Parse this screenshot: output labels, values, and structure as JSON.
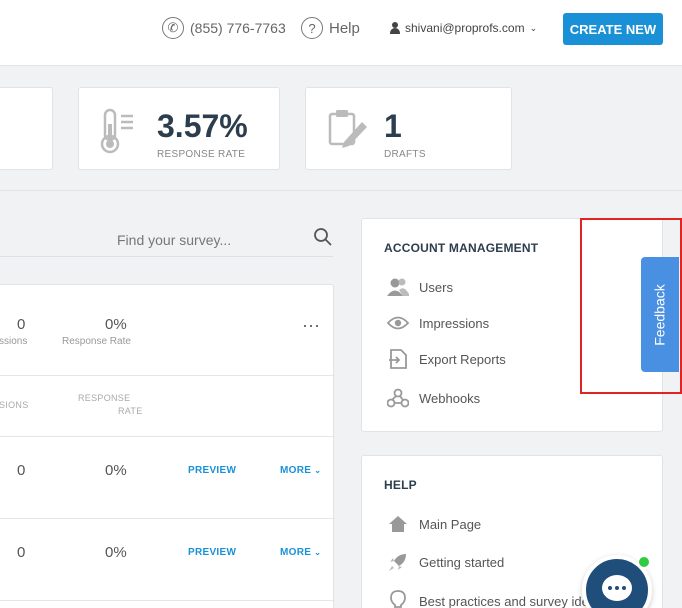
{
  "header": {
    "phone": "(855) 776-7763",
    "help_label": "Help",
    "user_email": "shivani@proprofs.com",
    "create_label": "CREATE NEW"
  },
  "stats": [
    {
      "value": "3.57%",
      "label": "RESPONSE RATE",
      "icon": "thermometer-icon"
    },
    {
      "value": "1",
      "label": "DRAFTS",
      "icon": "clipboard-pencil-icon"
    }
  ],
  "search": {
    "placeholder": "Find your survey..."
  },
  "survey_card": {
    "summary": {
      "impressions_value": "0",
      "impressions_label": "ssions",
      "response_value": "0%",
      "response_label": "Response Rate"
    },
    "columns": {
      "impressions": "SIONS",
      "response_line1": "RESPONSE",
      "response_line2": "RATE"
    },
    "rows": [
      {
        "impressions": "0",
        "response": "0%",
        "preview": "PREVIEW",
        "more": "MORE"
      },
      {
        "impressions": "0",
        "response": "0%",
        "preview": "PREVIEW",
        "more": "MORE"
      }
    ]
  },
  "account": {
    "title": "ACCOUNT MANAGEMENT",
    "items": [
      {
        "label": "Users",
        "icon": "users-icon"
      },
      {
        "label": "Impressions",
        "icon": "eye-icon"
      },
      {
        "label": "Export Reports",
        "icon": "export-icon"
      },
      {
        "label": "Webhooks",
        "icon": "webhook-icon"
      }
    ]
  },
  "help_card": {
    "title": "HELP",
    "items": [
      {
        "label": "Main Page",
        "icon": "home-icon"
      },
      {
        "label": "Getting started",
        "icon": "rocket-icon"
      },
      {
        "label": "Best practices and survey ide",
        "icon": "lightbulb-icon"
      }
    ]
  },
  "feedback": {
    "label": "Feedback"
  },
  "colors": {
    "accent": "#1a91d6",
    "feedback": "#4a90e2",
    "highlight": "#e02424",
    "chat": "#1f4e7a"
  }
}
